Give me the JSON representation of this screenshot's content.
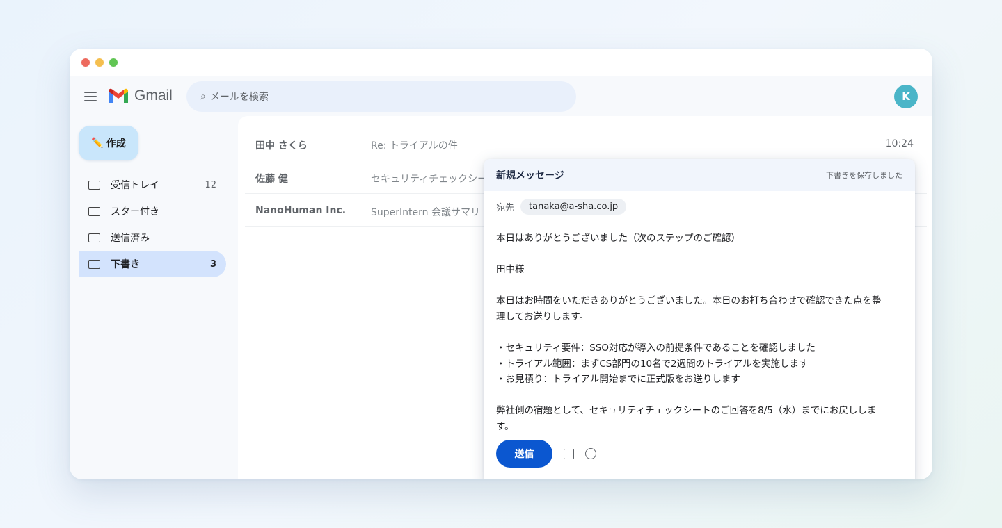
{
  "app": {
    "brand": "Gmail",
    "avatar_initial": "K"
  },
  "search": {
    "placeholder": "メールを検索",
    "icon": "search-icon"
  },
  "compose_button": {
    "label": "作成",
    "icon": "✏️"
  },
  "sidebar": {
    "items": [
      {
        "label": "受信トレイ",
        "count": "12",
        "icon": "inbox-icon"
      },
      {
        "label": "スター付き",
        "count": "",
        "icon": "star-icon"
      },
      {
        "label": "送信済み",
        "count": "",
        "icon": "sent-icon"
      },
      {
        "label": "下書き",
        "count": "3",
        "icon": "drafts-icon",
        "active": true
      }
    ]
  },
  "mail_list": [
    {
      "sender": "田中 さくら",
      "subject": "Re: トライアルの件",
      "time": "10:24"
    },
    {
      "sender": "佐藤 健",
      "subject": "セキュリティチェックシー",
      "time": ""
    },
    {
      "sender": "NanoHuman Inc.",
      "subject": "SuperIntern 会議サマリ",
      "time": ""
    }
  ],
  "composer": {
    "title": "新規メッセージ",
    "draft_status": "下書きを保存しました",
    "to_label": "宛先",
    "to_value": "tanaka@a-sha.co.jp",
    "subject": "本日はありがとうございました（次のステップのご確認）",
    "body_lines": [
      "田中様",
      "",
      "本日はお時間をいただきありがとうございました。本日のお打ち合わせで確認できた点を整",
      "理してお送りします。",
      "",
      "・セキュリティ要件：SSO対応が導入の前提条件であることを確認しました",
      "・トライアル範囲：まずCS部門の10名で2週間のトライアルを実施します",
      "・お見積り：トライアル開始までに正式版をお送りします",
      "",
      "弊社側の宿題として、セキュリティチェックシートのご回答を8/5（水）までにお戻ししま",
      "す。"
    ],
    "send_label": "送信"
  },
  "colors": {
    "accent": "#0b57d0",
    "active_nav": "#d3e3fd",
    "avatar": "#4ab5c8",
    "compose": "#c9e6fb"
  }
}
